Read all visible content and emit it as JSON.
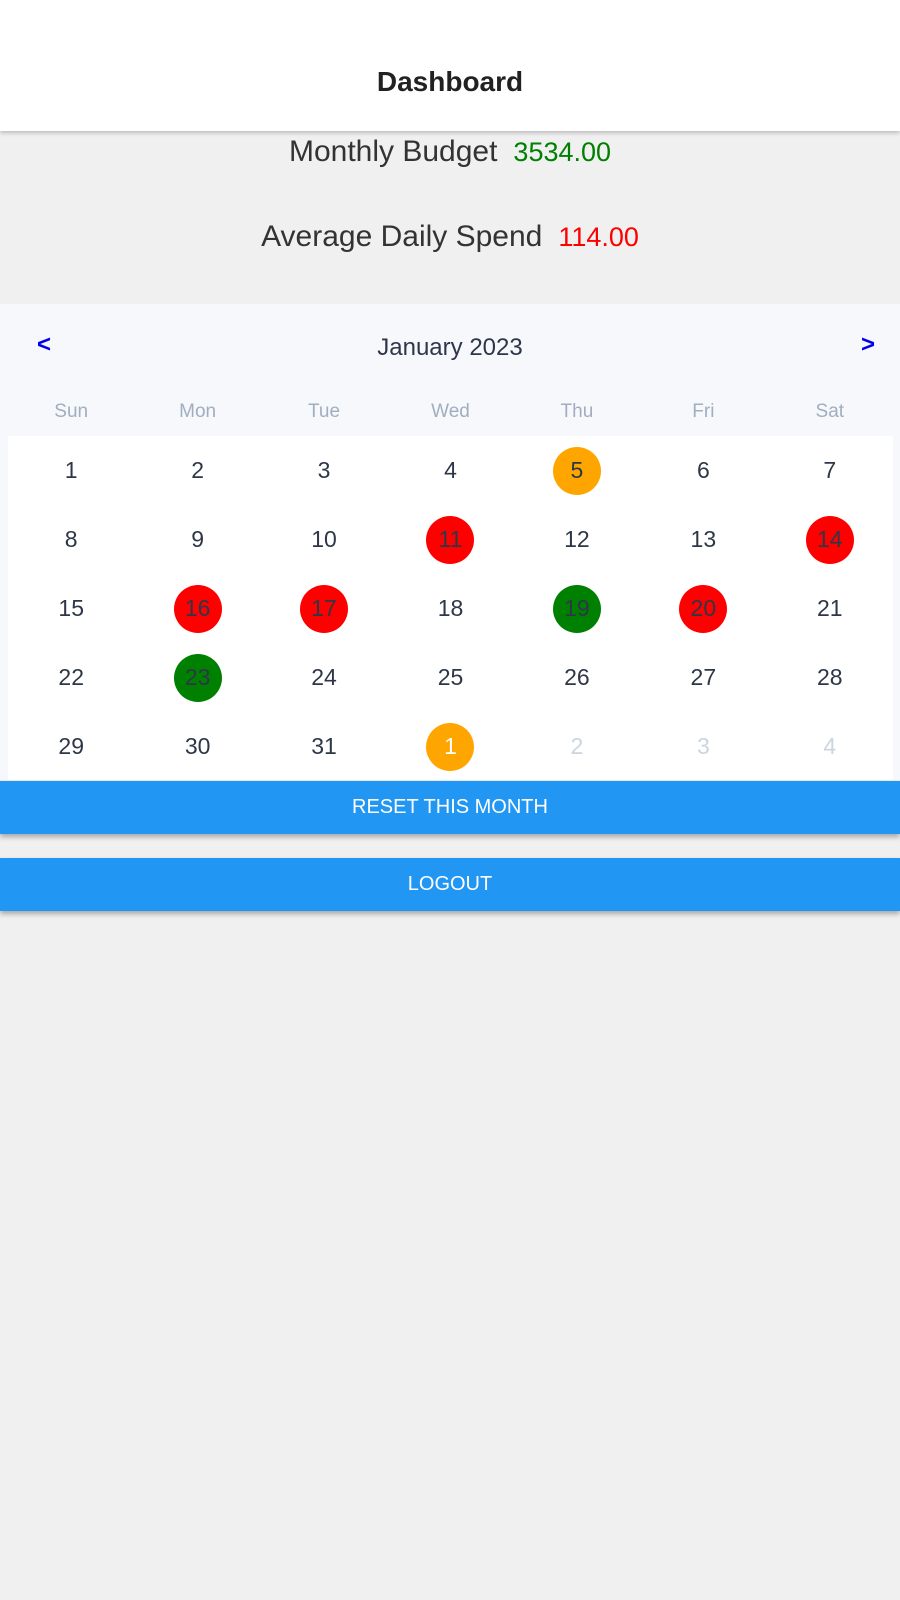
{
  "header": {
    "title": "Dashboard"
  },
  "stats": {
    "budget": {
      "label": "Monthly Budget",
      "value": "3534.00",
      "color": "#008000"
    },
    "avg_daily": {
      "label": "Average Daily Spend",
      "value": "114.00",
      "color": "#ff0000"
    }
  },
  "calendar": {
    "month_label": "January 2023",
    "prev_label": "<",
    "next_label": ">",
    "weekdays": [
      "Sun",
      "Mon",
      "Tue",
      "Wed",
      "Thu",
      "Fri",
      "Sat"
    ],
    "status_colors": {
      "orange": "#ffa500",
      "red": "#ff0000",
      "green": "#008000"
    },
    "days": [
      {
        "label": "1"
      },
      {
        "label": "2"
      },
      {
        "label": "3"
      },
      {
        "label": "4"
      },
      {
        "label": "5",
        "status": "orange"
      },
      {
        "label": "6"
      },
      {
        "label": "7"
      },
      {
        "label": "8"
      },
      {
        "label": "9"
      },
      {
        "label": "10"
      },
      {
        "label": "11",
        "status": "red"
      },
      {
        "label": "12"
      },
      {
        "label": "13"
      },
      {
        "label": "14",
        "status": "red"
      },
      {
        "label": "15"
      },
      {
        "label": "16",
        "status": "red"
      },
      {
        "label": "17",
        "status": "red"
      },
      {
        "label": "18"
      },
      {
        "label": "19",
        "status": "green"
      },
      {
        "label": "20",
        "status": "red"
      },
      {
        "label": "21"
      },
      {
        "label": "22"
      },
      {
        "label": "23",
        "status": "green"
      },
      {
        "label": "24"
      },
      {
        "label": "25"
      },
      {
        "label": "26"
      },
      {
        "label": "27"
      },
      {
        "label": "28"
      },
      {
        "label": "29"
      },
      {
        "label": "30"
      },
      {
        "label": "31"
      },
      {
        "label": "1",
        "status": "orange",
        "outside": true
      },
      {
        "label": "2",
        "outside": true
      },
      {
        "label": "3",
        "outside": true
      },
      {
        "label": "4",
        "outside": true
      }
    ]
  },
  "actions": {
    "reset_label": "RESET THIS MONTH",
    "logout_label": "LOGOUT"
  }
}
